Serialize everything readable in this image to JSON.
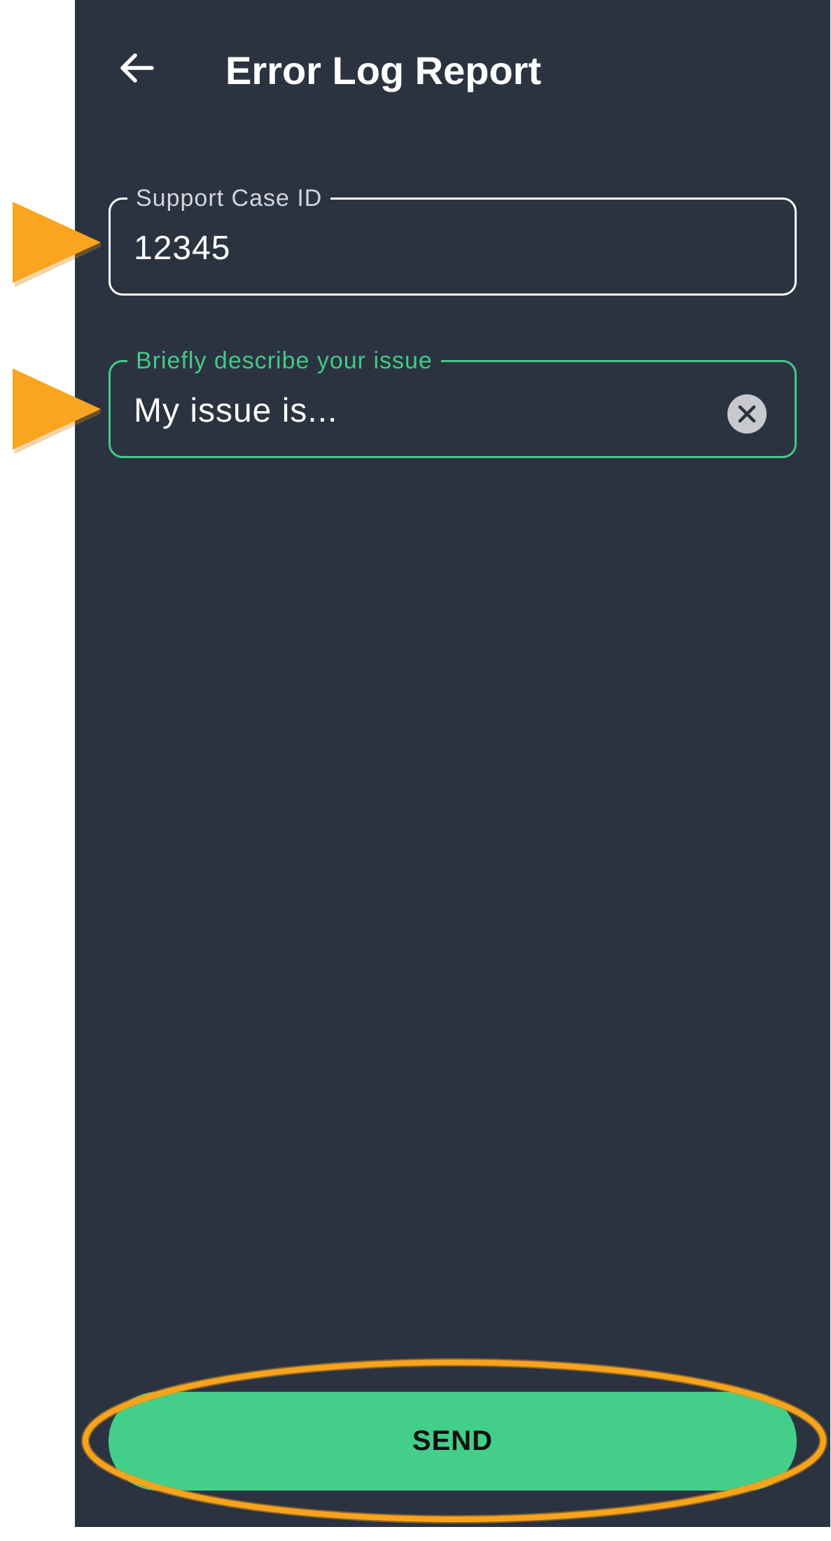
{
  "header": {
    "back_icon": "arrow-left-icon",
    "title": "Error Log Report"
  },
  "form": {
    "support_case": {
      "label": "Support Case ID",
      "value": "12345"
    },
    "issue": {
      "label": "Briefly describe your issue",
      "value": "My issue is...",
      "clear_icon": "clear-circle-icon"
    }
  },
  "actions": {
    "send_label": "SEND"
  },
  "annotations": {
    "pointer_icon": "orange-triangle-pointer-icon",
    "ring_icon": "orange-ellipse-highlight-icon",
    "pointer_color": "#f9a51f",
    "ring_color": "#f7a41c"
  },
  "colors": {
    "background": "#2c3340",
    "accent": "#43c987",
    "field_border": "#ffffff",
    "text": "#ffffff"
  }
}
